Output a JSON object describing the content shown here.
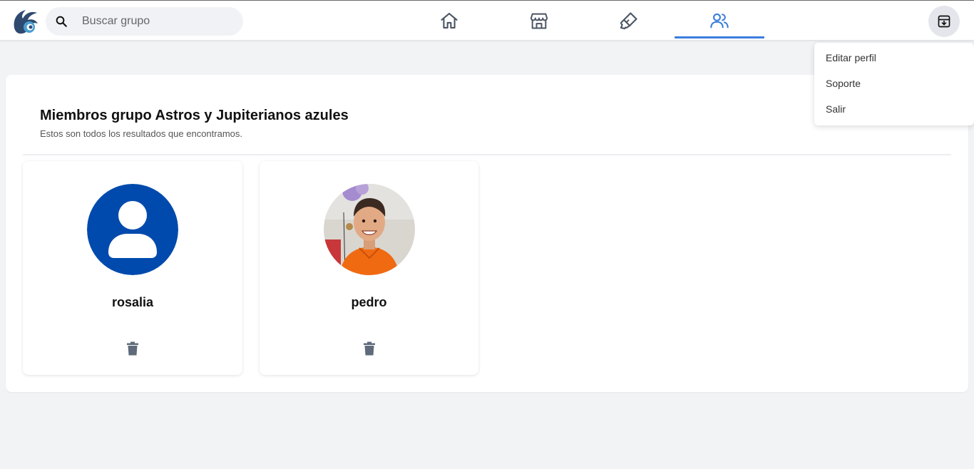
{
  "colors": {
    "accent": "#3b7ddd",
    "avatar_blue": "#004aad",
    "icon_gray": "#5f6b7a"
  },
  "header": {
    "search": {
      "placeholder": "Buscar grupo",
      "value": ""
    },
    "tabs": [
      {
        "icon": "home-icon",
        "active": false
      },
      {
        "icon": "store-icon",
        "active": false
      },
      {
        "icon": "brush-icon",
        "active": false
      },
      {
        "icon": "users-icon",
        "active": true
      }
    ],
    "profile_icon": "archive-box-icon"
  },
  "dropdown": {
    "items": [
      {
        "label": "Editar perfil"
      },
      {
        "label": "Soporte"
      },
      {
        "label": "Salir"
      }
    ]
  },
  "main": {
    "title": "Miembros grupo Astros y Jupiterianos azules",
    "subtitle": "Estos son todos los resultados que encontramos.",
    "members": [
      {
        "name": "rosalia",
        "avatar": "default-user-avatar"
      },
      {
        "name": "pedro",
        "avatar": "photo-avatar"
      }
    ]
  }
}
